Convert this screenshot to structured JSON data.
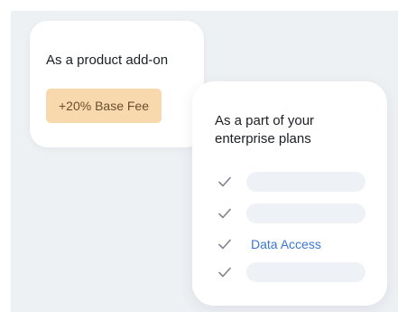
{
  "addon_card": {
    "title": "As a product add-on",
    "badge": "+20% Base Fee",
    "badge_color": "#f8d9ad"
  },
  "enterprise_card": {
    "title": "As a part of your enterprise plans",
    "features": [
      {
        "icon": "check-icon",
        "label": ""
      },
      {
        "icon": "check-icon",
        "label": ""
      },
      {
        "icon": "check-icon",
        "label": "Data Access"
      },
      {
        "icon": "check-icon",
        "label": ""
      }
    ],
    "highlight_color": "#3a76d3"
  }
}
